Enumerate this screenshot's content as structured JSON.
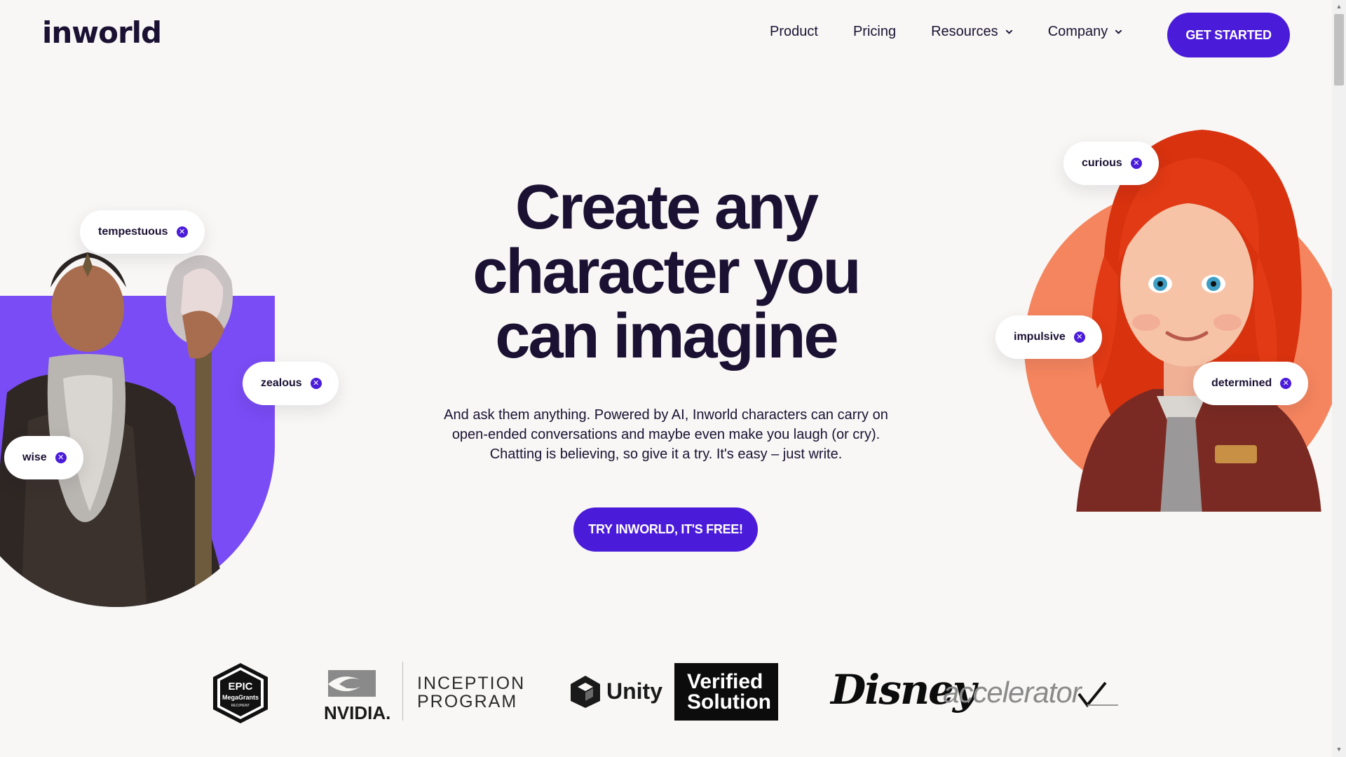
{
  "header": {
    "logo": "inworld",
    "nav": [
      {
        "label": "Product",
        "dropdown": false
      },
      {
        "label": "Pricing",
        "dropdown": false
      },
      {
        "label": "Resources",
        "dropdown": true
      },
      {
        "label": "Company",
        "dropdown": true
      }
    ],
    "cta": "GET STARTED"
  },
  "hero": {
    "title_line1": "Create any",
    "title_line2": "character you",
    "title_line3": "can imagine",
    "subtitle": "And ask them anything. Powered by AI, Inworld characters can carry on open-ended conversations and maybe even make you laugh (or cry). Chatting is believing, so give it a try. It's easy – just write.",
    "cta": "TRY INWORLD, IT'S FREE!"
  },
  "tags_left": [
    "tempestuous",
    "zealous",
    "wise"
  ],
  "tags_right": [
    "curious",
    "impulsive",
    "determined"
  ],
  "partners": {
    "epic_line1": "EPIC",
    "epic_line2": "MegaGrants",
    "epic_line3": "RECIPIENT",
    "nvidia": "NVIDIA.",
    "inception_line1": "INCEPTION",
    "inception_line2": "PROGRAM",
    "unity": "Unity",
    "verified_line1": "Verified",
    "verified_line2": "Solution",
    "disney": "Disney",
    "accelerator": "accelerator"
  },
  "colors": {
    "brand": "#4b1bda",
    "wizard_bg": "#7a4cf5",
    "girl_bg": "#f5855e",
    "text": "#1b1233",
    "page_bg": "#f8f7f5"
  },
  "icons": {
    "tag_remove": "close-circle-icon",
    "nav_dropdown": "chevron-down-icon"
  }
}
